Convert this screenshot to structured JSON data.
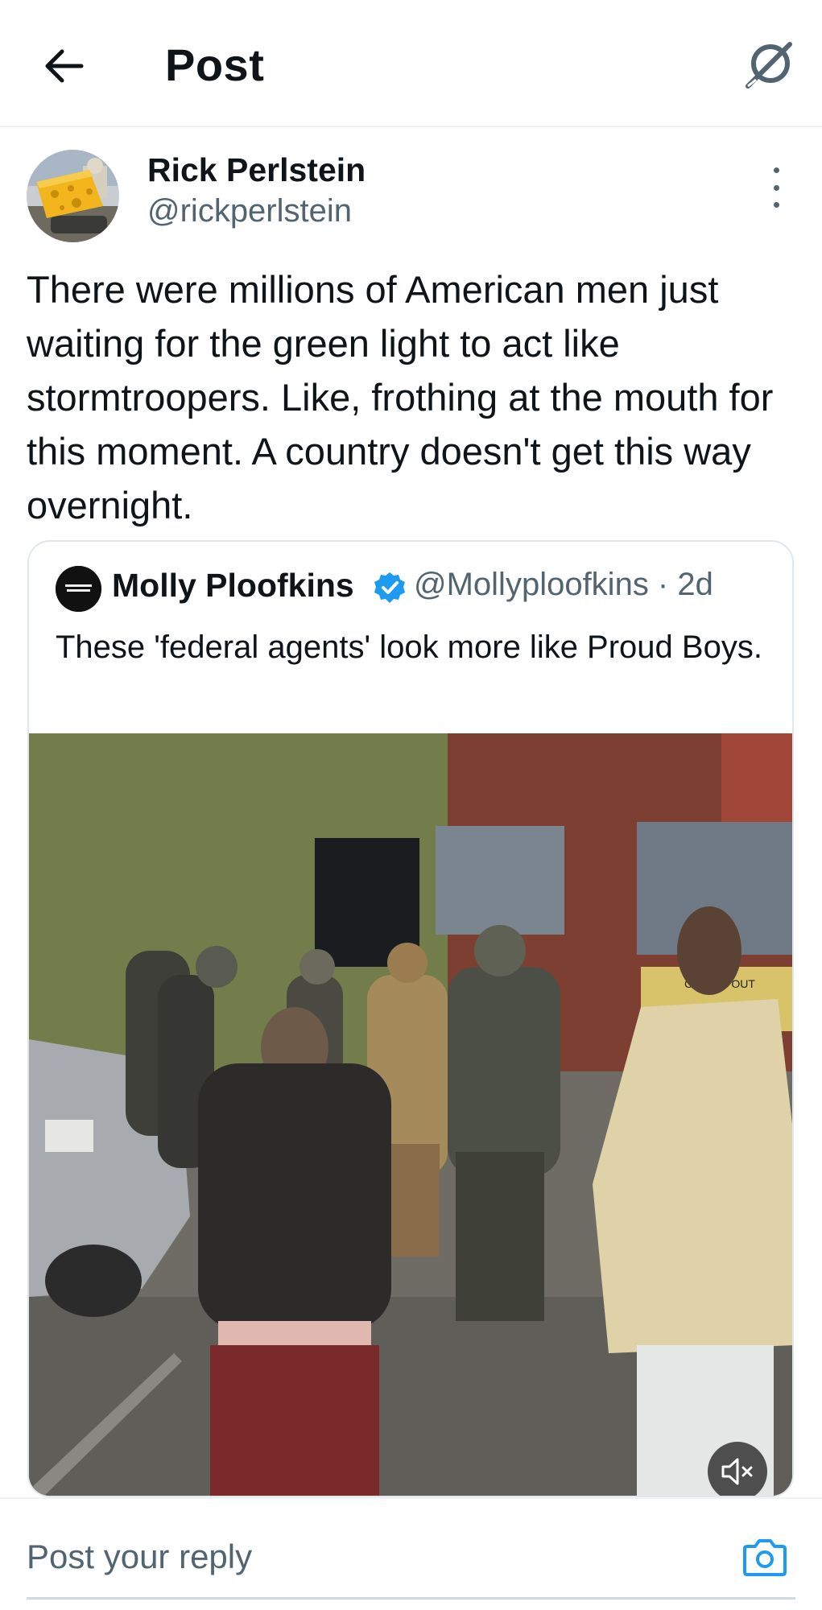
{
  "header": {
    "title": "Post",
    "back_icon": "arrow-left-icon",
    "grok_icon": "grok-icon"
  },
  "post": {
    "author_name": "Rick Perlstein",
    "author_handle": "@rickperlstein",
    "text": "There were millions of American men just waiting for the green light to act like stormtroopers. Like, frothing at the mouth for this moment. A country doesn't get this way overnight.",
    "more_icon": "more-vertical-icon"
  },
  "quote": {
    "author_name": "Molly Ploofkins",
    "verified": true,
    "handle_and_time": "@Mollyploofkins · 2d",
    "text": "These 'federal agents' look more like Proud Boys.",
    "avatar_text": "JUST SAY NO TO FASCISM",
    "media": {
      "type": "video",
      "muted": true,
      "mute_icon": "speaker-muted-icon",
      "sign_text": "CROWD OUT"
    }
  },
  "reply": {
    "placeholder": "Post your reply",
    "camera_icon": "camera-icon"
  },
  "colors": {
    "accent": "#1d9bf0",
    "text": "#0f1419",
    "secondary": "#536471"
  }
}
